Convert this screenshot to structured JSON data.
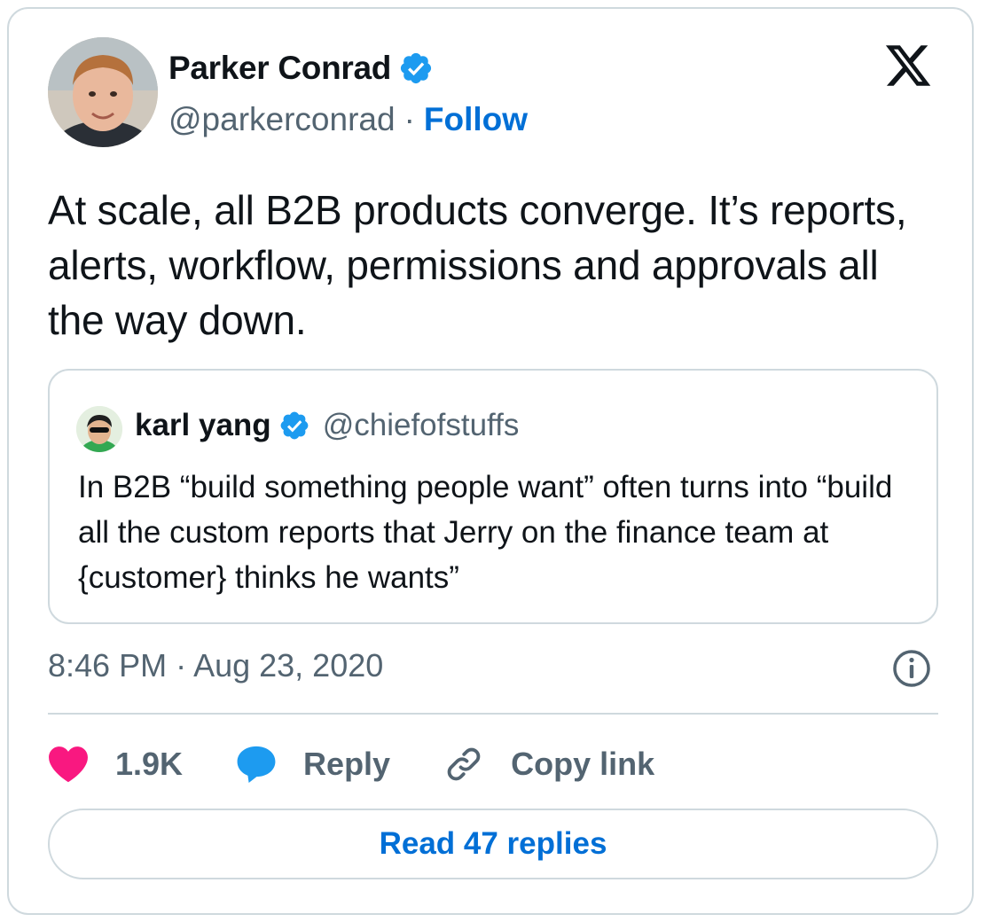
{
  "tweet": {
    "author": {
      "name": "Parker Conrad",
      "handle": "@parkerconrad",
      "separator": "·",
      "follow_label": "Follow",
      "verified": true
    },
    "text": "At scale, all B2B products converge. It’s reports, alerts, workflow, permissions and approvals all the way down.",
    "quoted": {
      "name": "karl yang",
      "handle": "@chiefofstuffs",
      "verified": true,
      "text": "In B2B “build something people want” often turns into “build all the custom reports that Jerry on the finance team at {customer} thinks he wants”"
    },
    "timestamp": "8:46 PM · Aug 23, 2020",
    "actions": {
      "likes_label": "1.9K",
      "reply_label": "Reply",
      "copy_link_label": "Copy link"
    },
    "read_replies_label": "Read 47 replies"
  },
  "colors": {
    "link": "#006fd6",
    "verified": "#1d9bf0",
    "like": "#f91880",
    "reply_bubble": "#1d9bf0",
    "muted_text": "#536471",
    "border": "#cfd9de"
  },
  "icons": {
    "platform": "x-logo-icon",
    "verified": "verified-badge-icon",
    "info": "info-icon",
    "like": "heart-icon",
    "reply": "speech-bubble-icon",
    "copy_link": "link-icon"
  }
}
